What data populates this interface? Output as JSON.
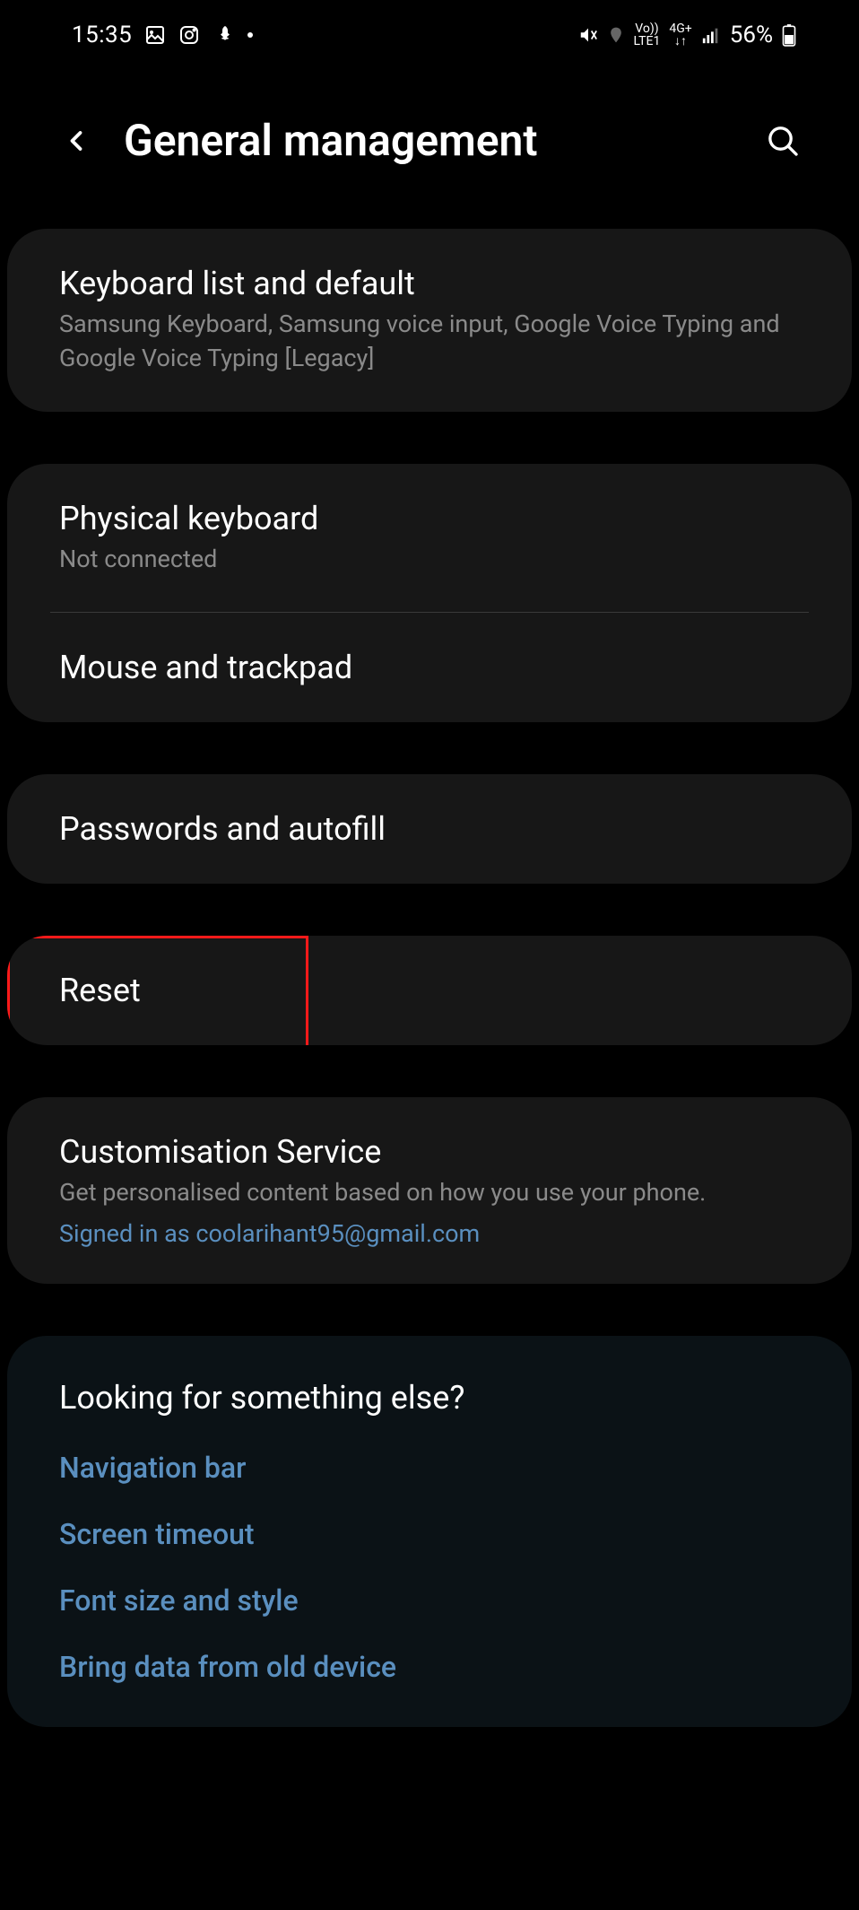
{
  "status_bar": {
    "time": "15:35",
    "battery_pct": "56%"
  },
  "header": {
    "title": "General management"
  },
  "cards": {
    "keyboard_list": {
      "title": "Keyboard list and default",
      "subtitle": "Samsung Keyboard, Samsung voice input, Google Voice Typing and Google Voice Typing [Legacy]"
    },
    "physical_keyboard": {
      "title": "Physical keyboard",
      "subtitle": "Not connected"
    },
    "mouse_trackpad": {
      "title": "Mouse and trackpad"
    },
    "passwords_autofill": {
      "title": "Passwords and autofill"
    },
    "reset": {
      "title": "Reset"
    },
    "customisation": {
      "title": "Customisation Service",
      "subtitle": "Get personalised content based on how you use your phone.",
      "signed_in": "Signed in as coolarihant95@gmail.com"
    }
  },
  "looking": {
    "title": "Looking for something else?",
    "links": {
      "nav_bar": "Navigation bar",
      "screen_timeout": "Screen timeout",
      "font_size": "Font size and style",
      "bring_data": "Bring data from old device"
    }
  }
}
